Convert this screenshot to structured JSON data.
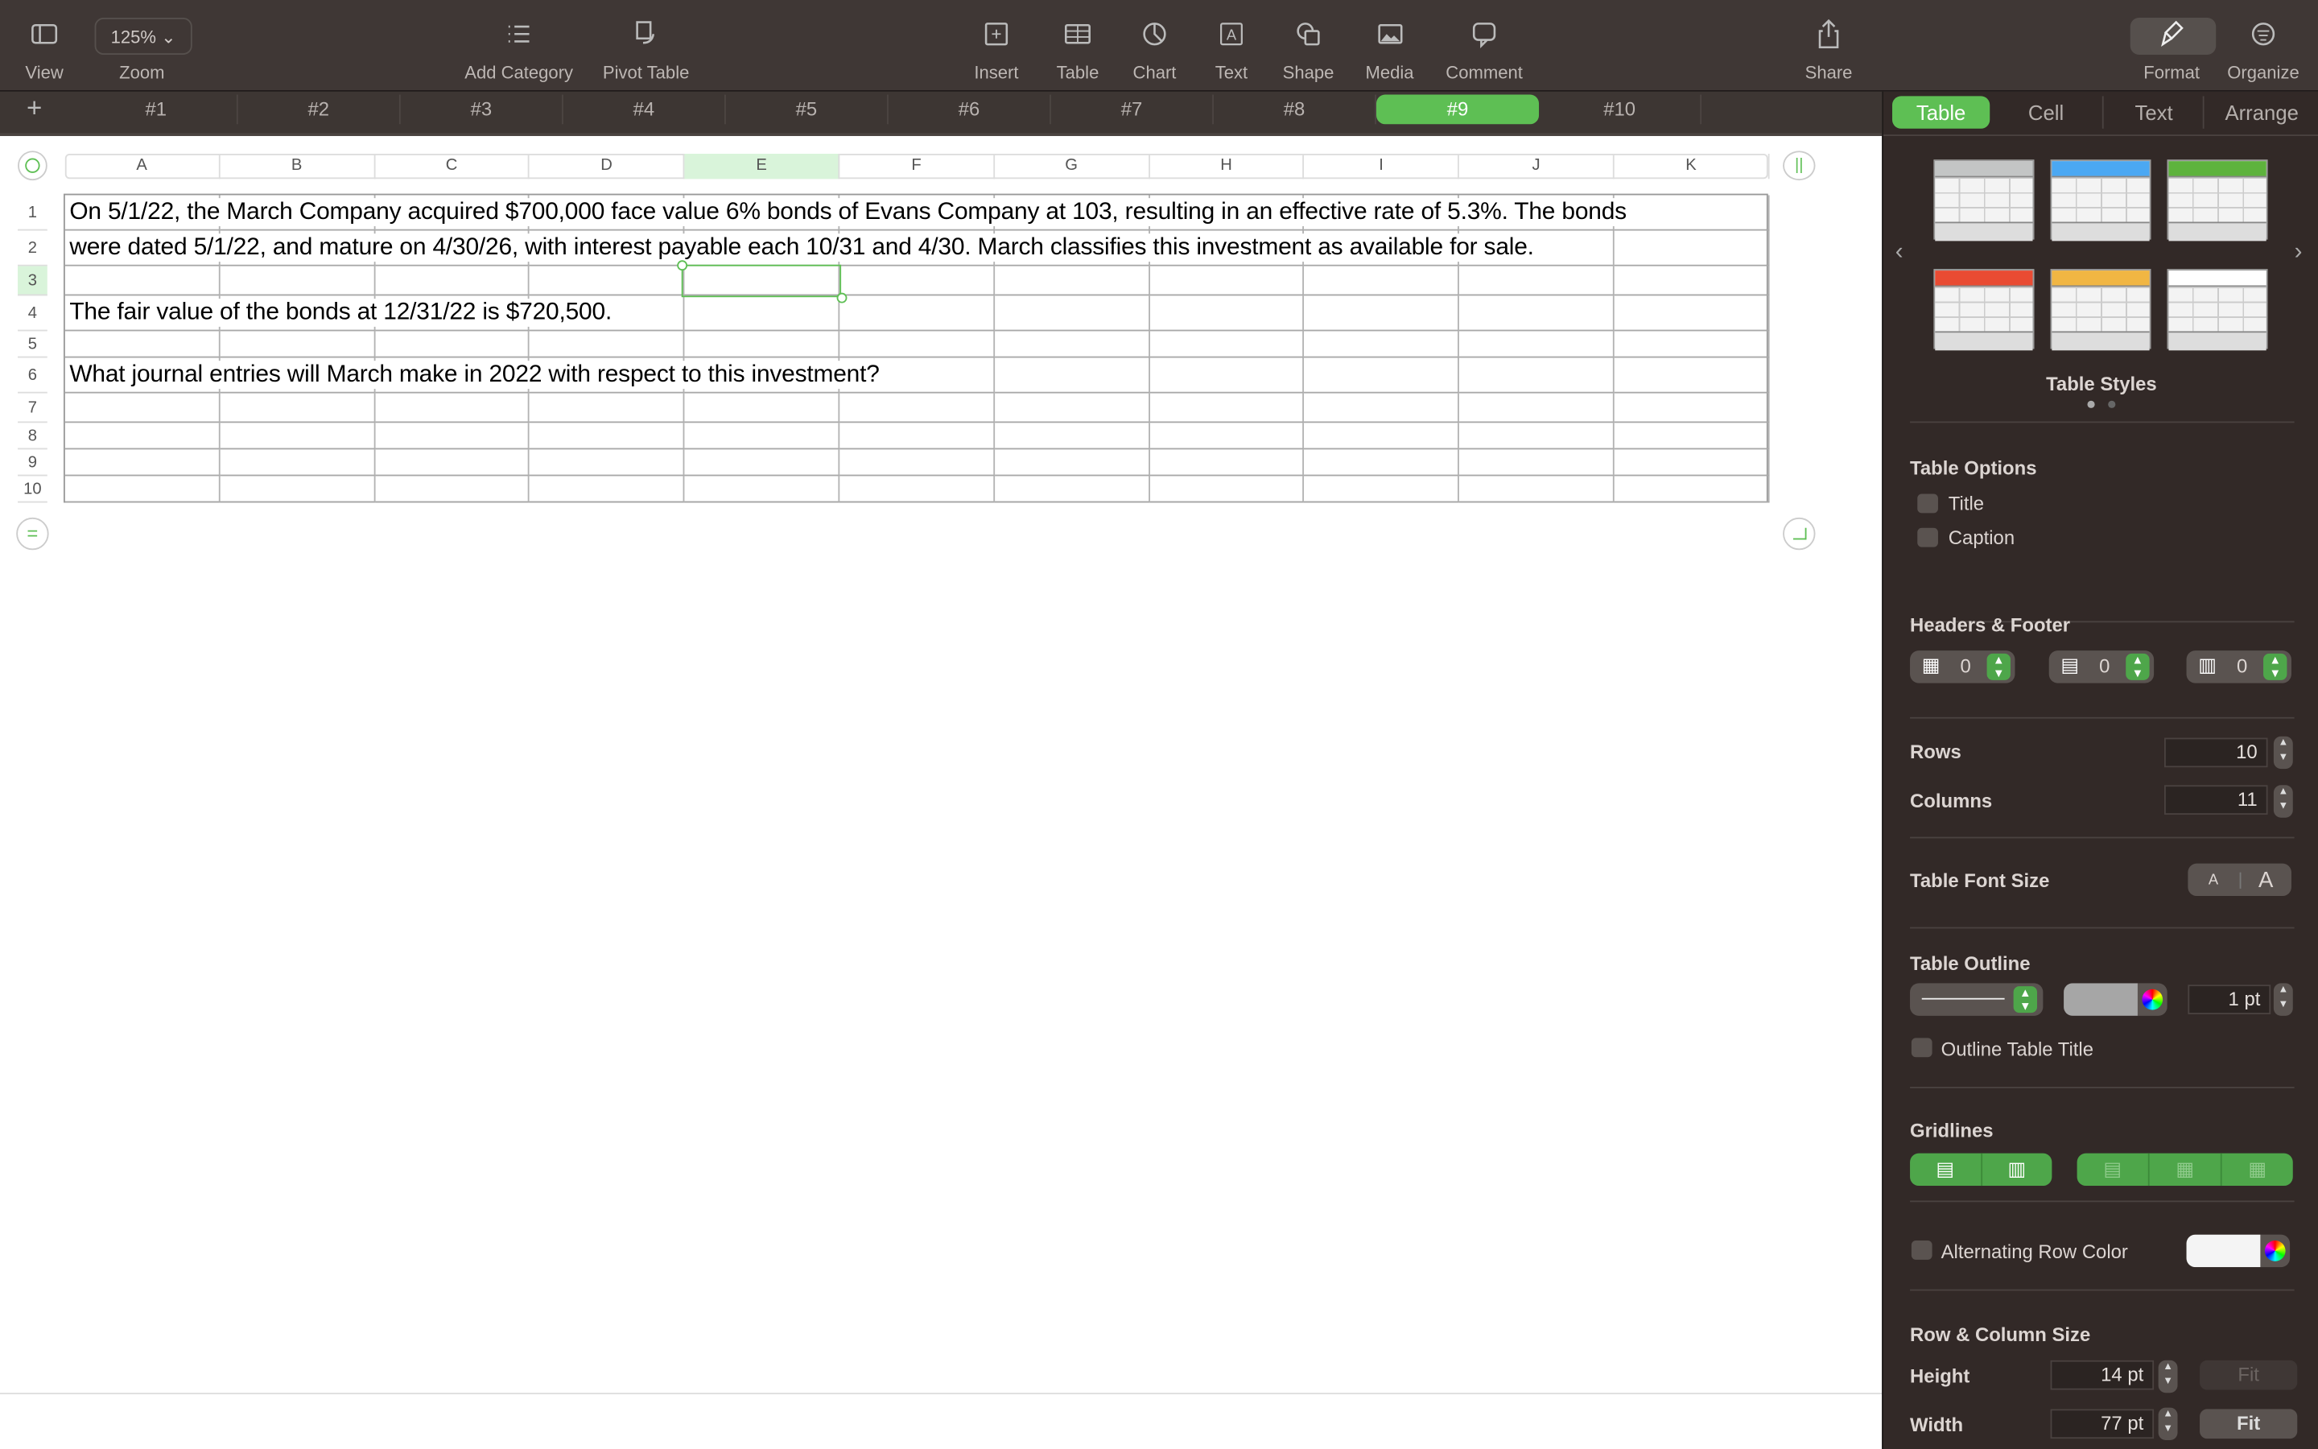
{
  "toolbar": {
    "items": [
      {
        "label": "View",
        "icon": "sidebar-icon"
      },
      {
        "label": "Zoom",
        "icon": "zoom-dropdown"
      },
      {
        "label": "Add Category",
        "icon": "list-icon"
      },
      {
        "label": "Pivot Table",
        "icon": "pivot-table-icon"
      },
      {
        "label": "Insert",
        "icon": "insert-icon"
      },
      {
        "label": "Table",
        "icon": "table-icon"
      },
      {
        "label": "Chart",
        "icon": "chart-icon"
      },
      {
        "label": "Text",
        "icon": "text-box-icon"
      },
      {
        "label": "Shape",
        "icon": "shape-icon"
      },
      {
        "label": "Media",
        "icon": "media-icon"
      },
      {
        "label": "Comment",
        "icon": "comment-icon"
      },
      {
        "label": "Share",
        "icon": "share-icon"
      },
      {
        "label": "Format",
        "icon": "paintbrush-icon"
      },
      {
        "label": "Organize",
        "icon": "organize-icon"
      }
    ],
    "zoom_value": "125%"
  },
  "sheets": {
    "add": "+",
    "tabs": [
      "#1",
      "#2",
      "#3",
      "#4",
      "#5",
      "#6",
      "#7",
      "#8",
      "#9",
      "#10"
    ],
    "active": "#9"
  },
  "spreadsheet": {
    "columns": [
      "A",
      "B",
      "C",
      "D",
      "E",
      "F",
      "G",
      "H",
      "I",
      "J",
      "K"
    ],
    "rows": [
      "1",
      "2",
      "3",
      "4",
      "5",
      "6",
      "7",
      "8",
      "9",
      "10"
    ],
    "selected_cell": "E3",
    "text": {
      "row1": "On 5/1/22, the March Company acquired $700,000 face value 6% bonds of Evans Company at 103, resulting in an effective rate of 5.3%. The bonds",
      "row2": "were dated 5/1/22, and mature on 4/30/26, with interest payable each 10/31 and 4/30.  March classifies this investment as available for sale.",
      "row4": "The fair value of the bonds at 12/31/22 is $720,500.",
      "row6": "What journal entries will March make in 2022 with respect to this investment?"
    }
  },
  "panel": {
    "tabs": [
      "Table",
      "Cell",
      "Text",
      "Arrange"
    ],
    "active_tab": "Table",
    "table_styles_label": "Table Styles",
    "style_colors": [
      "#c3c5c5",
      "#4ba8f3",
      "#5eb33d",
      "#e94b33",
      "#f1b643",
      "#ffffff"
    ],
    "table_options": {
      "heading": "Table Options",
      "title": "Title",
      "caption": "Caption",
      "title_checked": false,
      "caption_checked": false
    },
    "headers_footer": {
      "heading": "Headers & Footer",
      "header_rows": "0",
      "header_columns": "0",
      "footer_rows": "0"
    },
    "rows_label": "Rows",
    "rows_value": "10",
    "columns_label": "Columns",
    "columns_value": "11",
    "font_size_label": "Table Font Size",
    "font_small": "A",
    "font_large": "A",
    "outline": {
      "heading": "Table Outline",
      "width": "1 pt",
      "color": "#a6a6a6",
      "outline_title_label": "Outline Table Title"
    },
    "gridlines_heading": "Gridlines",
    "alternating": {
      "label": "Alternating Row Color",
      "color": "#f4f4f4"
    },
    "size": {
      "heading": "Row & Column Size",
      "height_label": "Height",
      "height_value": "14 pt",
      "width_label": "Width",
      "width_value": "77 pt",
      "fit": "Fit"
    }
  },
  "colors": {
    "accent": "#5ebf54",
    "toolbar_bg": "#3f3735",
    "panel_bg": "#322927"
  }
}
